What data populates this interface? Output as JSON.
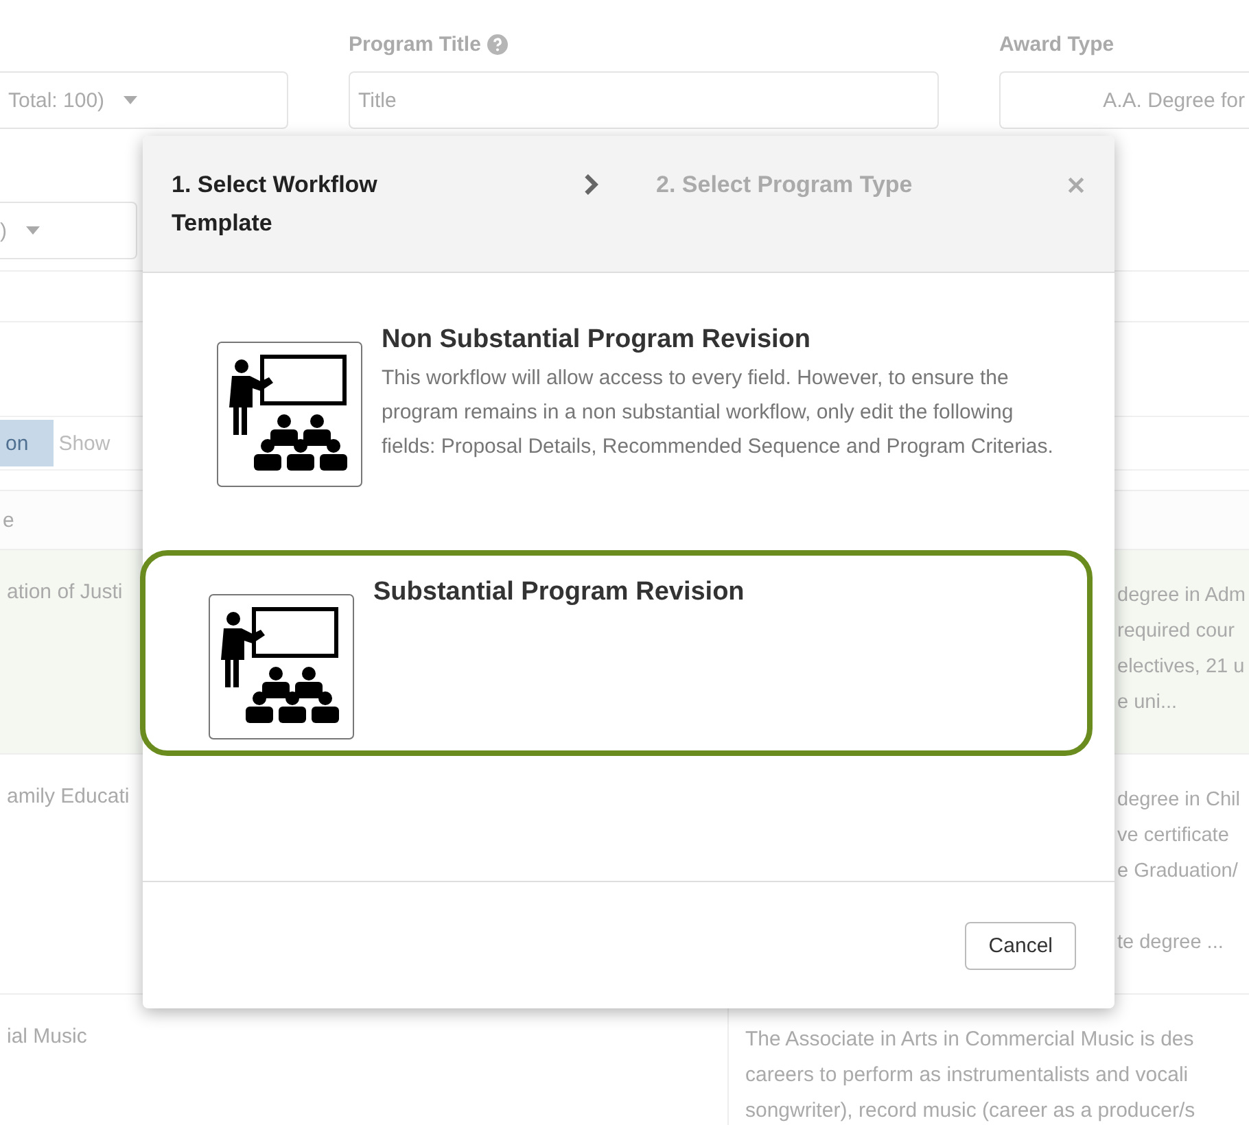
{
  "filters": [
    {
      "kind": "select",
      "value": "Total: 100)"
    },
    {
      "kind": "text",
      "label": "Program Title",
      "help": true,
      "placeholder": "Title"
    },
    {
      "kind": "text",
      "label": "Award Type",
      "value": "A.A. Degree for"
    }
  ],
  "second_select": {
    "value": ")"
  },
  "view_tabs": [
    {
      "label": "on",
      "selected": true
    },
    {
      "label": "Show",
      "selected": false
    }
  ],
  "table": {
    "column_1_header": "e",
    "rows": [
      {
        "highlighted": true,
        "partly_hidden": true,
        "column_1": "ation of Justi",
        "column_2": [
          [
            "degree in Adm",
            "required cour",
            "electives, 21 u",
            "e uni..."
          ]
        ]
      },
      {
        "highlighted": false,
        "partly_hidden": true,
        "column_1": "amily Educati",
        "column_2": [
          [
            "degree in Chil",
            "ve certificate",
            "e Graduation/"
          ],
          [
            "te degree ..."
          ]
        ]
      },
      {
        "highlighted": false,
        "partly_hidden": false,
        "column_1": "ial Music",
        "column_2": [
          [
            "The Associate in Arts in Commercial Music is des",
            "careers to perform as instrumentalists and vocali",
            "songwriter), record music (career as a producer/s"
          ]
        ]
      }
    ]
  },
  "modal": {
    "steps": [
      {
        "label": "1. Select Workflow Template",
        "selected": true
      },
      {
        "label": "2. Select Program Type",
        "selected": false
      }
    ],
    "options": [
      {
        "title": "Non Substantial Program Revision",
        "description": "This workflow will allow access to every field. However, to ensure the program remains in a non substantial workflow, only edit the following fields: Proposal Details, Recommended Sequence and Program Criterias.",
        "selected": false
      },
      {
        "title": "Substantial Program Revision",
        "selected": true
      }
    ],
    "buttons": [
      "Cancel"
    ]
  }
}
